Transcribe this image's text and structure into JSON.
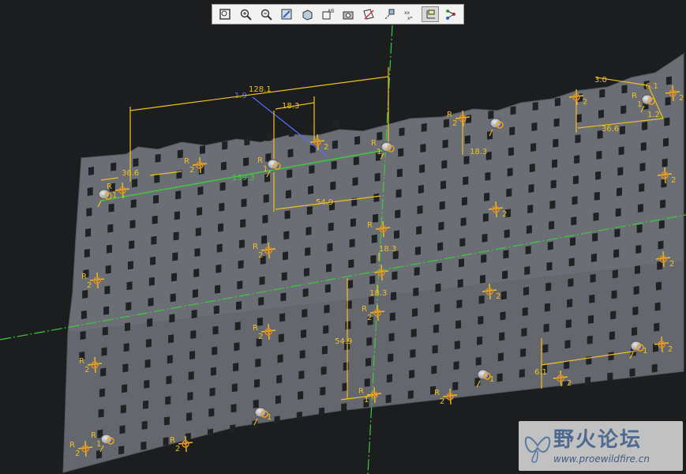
{
  "toolbar": {
    "items": [
      {
        "icon": "zoom-fit-icon"
      },
      {
        "icon": "zoom-in-icon"
      },
      {
        "icon": "zoom-out-icon"
      },
      {
        "icon": "repaint-icon"
      },
      {
        "icon": "display-style-icon"
      },
      {
        "icon": "saved-views-icon"
      },
      {
        "icon": "camera-icon"
      },
      {
        "icon": "datum-planes-icon"
      },
      {
        "icon": "datum-axes-icon"
      },
      {
        "icon": "point-display-icon"
      },
      {
        "icon": "coordinate-system-icon",
        "active": true
      },
      {
        "icon": "annotation-display-icon"
      }
    ]
  },
  "colors": {
    "background": "#1b1d1f",
    "plate": "#6b6e74",
    "dimension": "#f0c020",
    "datum": "#3ecb3e",
    "blue_dimension": "#5a6cff"
  },
  "dimensions": {
    "d128": "128.1",
    "d1_9": "1.9",
    "d18_3a": "18.3",
    "d139": "139.3",
    "d36_6a": "36.6",
    "d54_9a": "54.9",
    "d18_3b": "18.3",
    "d18_3c": "18.3",
    "d18_3d": "18.3",
    "d54_9b": "54.9",
    "d3_0": "3.0",
    "d6_1a": "6.1",
    "d36_6b": "36.6",
    "d1_2": "1.2",
    "d6_1b": "6.1"
  },
  "labels": {
    "r": "R",
    "one": "1",
    "two": "2"
  },
  "watermark": {
    "title": "野火论坛",
    "url": "www.proewildfire.cn"
  }
}
